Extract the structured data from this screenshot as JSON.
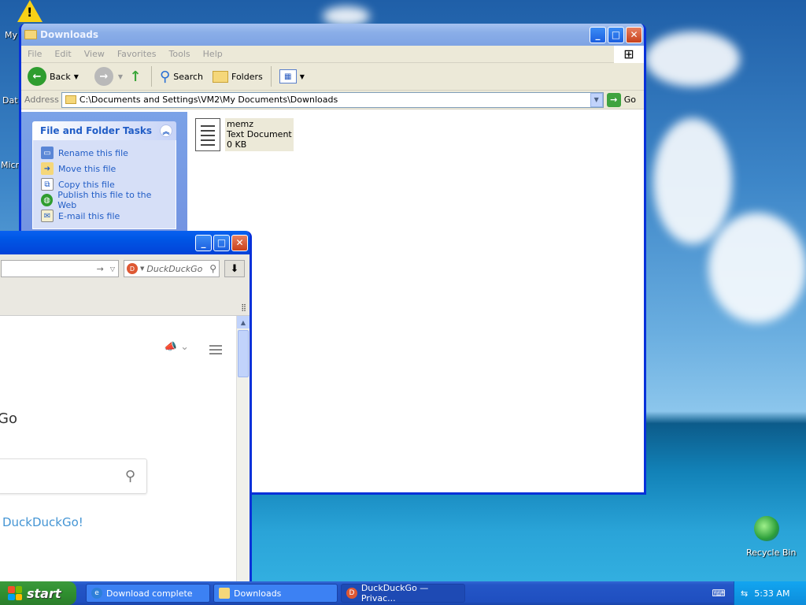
{
  "desktop": {
    "icons": [
      "My",
      "Dat",
      "Micr",
      "Recycle Bin"
    ]
  },
  "explorer": {
    "title": "Downloads",
    "menu": [
      "File",
      "Edit",
      "View",
      "Favorites",
      "Tools",
      "Help"
    ],
    "toolbar": {
      "back": "Back",
      "search": "Search",
      "folders": "Folders"
    },
    "address_label": "Address",
    "address_value": "C:\\Documents and Settings\\VM2\\My Documents\\Downloads",
    "go_label": "Go",
    "tasks_title": "File and Folder Tasks",
    "tasks": [
      "Rename this file",
      "Move this file",
      "Copy this file",
      "Publish this file to the Web",
      "E-mail this file"
    ],
    "file": {
      "name": "memz",
      "type": "Text Document",
      "size": "0 KB"
    }
  },
  "firefox": {
    "search_placeholder": "DuckDuckGo",
    "brand_fragment": "Go",
    "link_fragment": "DuckDuckGo!"
  },
  "taskbar": {
    "start_label": "start",
    "tasks": [
      "Download complete",
      "Downloads",
      "DuckDuckGo — Privac..."
    ],
    "clock": "5:33 AM"
  },
  "colors": {
    "xp_blue": "#0831d9",
    "start_green": "#3c9a3c",
    "link": "#215dc6"
  }
}
